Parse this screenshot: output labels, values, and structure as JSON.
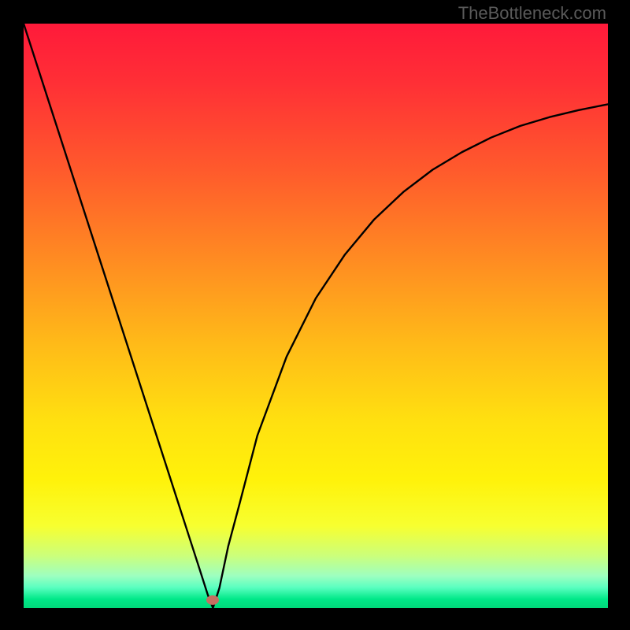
{
  "watermark": "TheBottleneck.com",
  "plot": {
    "background_gradient": {
      "stops": [
        {
          "offset": 0.0,
          "color": "#ff1a3a"
        },
        {
          "offset": 0.1,
          "color": "#ff2f36"
        },
        {
          "offset": 0.25,
          "color": "#ff5a2c"
        },
        {
          "offset": 0.4,
          "color": "#ff8a22"
        },
        {
          "offset": 0.55,
          "color": "#ffbb18"
        },
        {
          "offset": 0.68,
          "color": "#ffe010"
        },
        {
          "offset": 0.78,
          "color": "#fff20a"
        },
        {
          "offset": 0.86,
          "color": "#f7ff30"
        },
        {
          "offset": 0.91,
          "color": "#ccff7a"
        },
        {
          "offset": 0.945,
          "color": "#9effc0"
        },
        {
          "offset": 0.965,
          "color": "#5affc0"
        },
        {
          "offset": 0.985,
          "color": "#00e888"
        },
        {
          "offset": 1.0,
          "color": "#00d97a"
        }
      ]
    },
    "curve": {
      "color": "#000000",
      "width": 2.4
    },
    "marker": {
      "x_frac": 0.324,
      "y_frac": 0.986,
      "color": "#c57061"
    }
  },
  "chart_data": {
    "type": "line",
    "title": "",
    "xlabel": "",
    "ylabel": "",
    "xlim": [
      0,
      1
    ],
    "ylim": [
      0,
      1
    ],
    "series": [
      {
        "name": "bottleneck-curve",
        "x": [
          0.0,
          0.05,
          0.1,
          0.15,
          0.2,
          0.25,
          0.28,
          0.3,
          0.315,
          0.324,
          0.335,
          0.35,
          0.37,
          0.4,
          0.45,
          0.5,
          0.55,
          0.6,
          0.65,
          0.7,
          0.75,
          0.8,
          0.85,
          0.9,
          0.95,
          1.0
        ],
        "y": [
          1.0,
          0.845,
          0.69,
          0.535,
          0.38,
          0.225,
          0.132,
          0.07,
          0.023,
          0.0,
          0.034,
          0.105,
          0.18,
          0.295,
          0.43,
          0.53,
          0.605,
          0.665,
          0.712,
          0.75,
          0.78,
          0.805,
          0.825,
          0.84,
          0.852,
          0.862
        ]
      }
    ],
    "marker_point": {
      "x": 0.324,
      "y": 0.0
    }
  }
}
